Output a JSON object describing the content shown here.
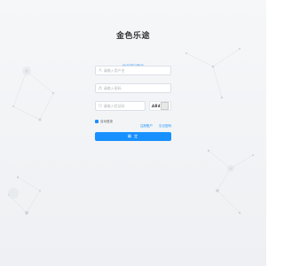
{
  "app": {
    "title": "金色乐途"
  },
  "tabs": [
    {
      "label": "账号密码登录",
      "active": true
    }
  ],
  "form": {
    "username_placeholder": "请输入用户名",
    "password_placeholder": "请输入密码",
    "captcha_placeholder": "请输入验证码",
    "captcha_code": "AB4",
    "remember_label": "自动登录",
    "register_link": "注册账户",
    "forgot_link": "忘记密码",
    "submit_label": "确 定"
  },
  "colors": {
    "accent": "#1890ff",
    "background": "#f2f3f5"
  },
  "icons": {
    "user": "user-icon",
    "lock": "lock-icon",
    "shield": "shield-icon"
  }
}
